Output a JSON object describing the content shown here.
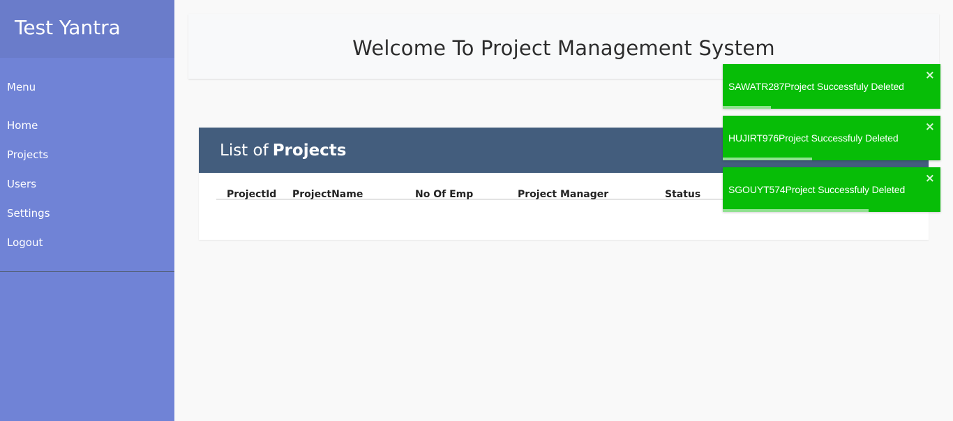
{
  "brand": {
    "title": "Test Yantra"
  },
  "sidebar": {
    "menu_label": "Menu",
    "items": [
      {
        "label": "Home"
      },
      {
        "label": "Projects"
      },
      {
        "label": "Users"
      },
      {
        "label": "Settings"
      },
      {
        "label": "Logout"
      }
    ]
  },
  "header": {
    "title": "Welcome To Project Management System"
  },
  "projects": {
    "title_prefix": "List of",
    "title_emphasis": "Projects",
    "columns": [
      "ProjectId",
      "ProjectName",
      "No Of Emp",
      "Project Manager",
      "Status"
    ]
  },
  "toasts": [
    {
      "message": "SAWATR287Project Successfuly Deleted",
      "close": "×",
      "progress_percent": 22
    },
    {
      "message": "HUJIRT976Project Successfuly Deleted",
      "close": "×",
      "progress_percent": 41
    },
    {
      "message": "SGOUYT574Project Successfuly Deleted",
      "close": "×",
      "progress_percent": 67
    }
  ],
  "colors": {
    "sidebar": "#7083d6",
    "brand_bar": "#6a7cca",
    "list_header": "#435d7d",
    "toast_success": "#07bd07"
  }
}
